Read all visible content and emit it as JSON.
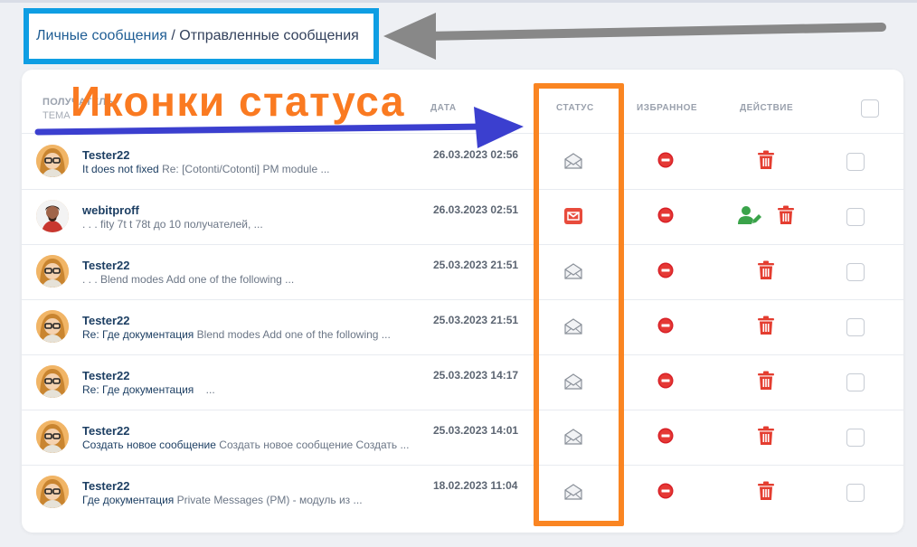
{
  "breadcrumb": {
    "link": "Личные сообщения",
    "separator": " / ",
    "current": "Отправленные сообщения"
  },
  "annotation": {
    "title": "Иконки статуса",
    "title_color": "#fa7a21",
    "frame_color": "#fa8522",
    "blue_arrow_color": "#3b3fcf",
    "gray_arrow_color": "#888888",
    "crumb_box_color": "#0f9ee3"
  },
  "table": {
    "headers": {
      "recipient": "ПОЛУЧАТЕЛЬ",
      "subject": "ТЕМА",
      "date": "ДАТА",
      "status": "СТАТУС",
      "favorite": "ИЗБРАННОЕ",
      "action": "ДЕЙСТВИЕ"
    },
    "rows": [
      {
        "sender": "Tester22",
        "subject": "It does not fixed",
        "snippet": " Re: [Cotonti/Cotonti] PM module ...",
        "date": "26.03.2023 02:56",
        "status_icon": "envelope-open-icon",
        "avatar": "avatar-tester22"
      },
      {
        "sender": "webitproff",
        "subject": "",
        "snippet": ". . . fity 7t t 78t до 10 получателей, ...",
        "date": "26.03.2023 02:51",
        "status_icon": "envelope-unread-icon",
        "avatar": "avatar-webitproff"
      },
      {
        "sender": "Tester22",
        "subject": "",
        "snippet": ". . . Blend modes Add one of the following ...",
        "date": "25.03.2023 21:51",
        "status_icon": "envelope-open-icon",
        "avatar": "avatar-tester22"
      },
      {
        "sender": "Tester22",
        "subject": "Re: Где документация",
        "snippet": " Blend modes Add one of the following ...",
        "date": "25.03.2023 21:51",
        "status_icon": "envelope-open-icon",
        "avatar": "avatar-tester22"
      },
      {
        "sender": "Tester22",
        "subject": "Re: Где документация",
        "snippet": "    ...",
        "date": "25.03.2023 14:17",
        "status_icon": "envelope-open-icon",
        "avatar": "avatar-tester22"
      },
      {
        "sender": "Tester22",
        "subject": "Создать новое сообщение",
        "snippet": " Создать новое сообщение Создать ...",
        "date": "25.03.2023 14:01",
        "status_icon": "envelope-open-icon",
        "avatar": "avatar-tester22"
      },
      {
        "sender": "Tester22",
        "subject": "Где документация",
        "snippet": " Private Messages (PM) - модуль из ...",
        "date": "18.02.2023 11:04",
        "status_icon": "envelope-open-icon",
        "avatar": "avatar-tester22"
      }
    ]
  }
}
